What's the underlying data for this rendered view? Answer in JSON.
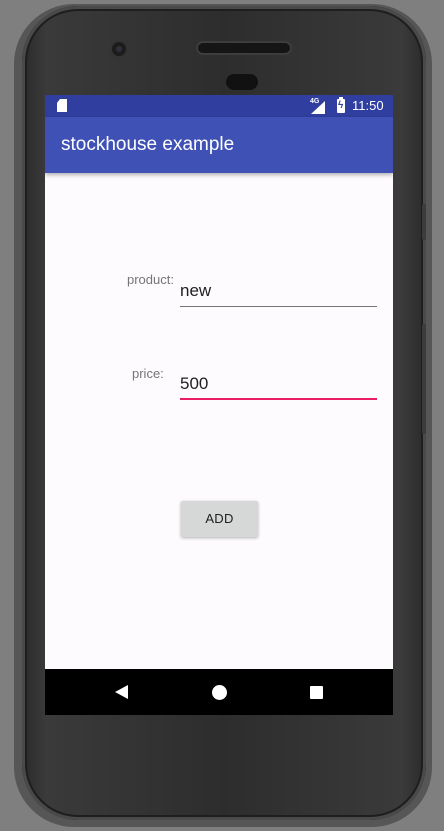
{
  "status_bar": {
    "network": "4G",
    "time": "11:50",
    "icons": [
      "sd-card-icon",
      "signal-icon",
      "battery-charging-icon"
    ]
  },
  "app_bar": {
    "title": "stockhouse example"
  },
  "form": {
    "product_label": "product:",
    "product_value": "new",
    "price_label": "price:",
    "price_value": "500",
    "add_button": "ADD"
  },
  "nav_bar": {
    "icons": [
      "back-icon",
      "home-icon",
      "recents-icon"
    ]
  },
  "colors": {
    "status_bar": "#303f9f",
    "app_bar": "#3f51b5",
    "focused_underline": "#e91e63",
    "underline": "#757575"
  }
}
